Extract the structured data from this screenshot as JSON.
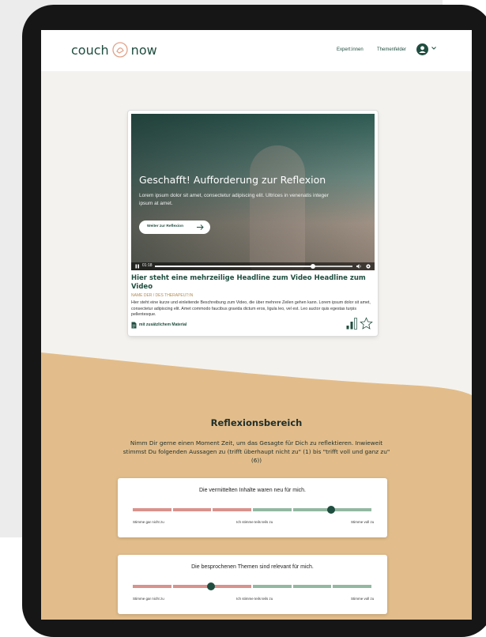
{
  "app": {
    "logo_left": "couch",
    "logo_right": "now",
    "nav": [
      {
        "label": "Expert:innen"
      },
      {
        "label": "Themenfelder"
      }
    ]
  },
  "video_card": {
    "overlay": {
      "headline": "Geschafft! Aufforderung zur Reflexion",
      "text": "Lorem ipsum dolor sit amet, consectetur adipiscing elit. Ultrices in venenatis integer ipsum at amet.",
      "button_label": "Weiter zur Reflexion"
    },
    "player": {
      "time": "01:18",
      "progress": 0.8
    },
    "title": "Hier steht eine mehrzeilige Headline zum Video Headline zum Video",
    "name": "NAME DER / DES THERAPEUT:IN",
    "description": "Hier steht eine kurze und einleitende Beschreibung zum Video, die über mehrere Zeilen gehen kann. Lorem ipsum dolor sit amet, consectetur adipiscing elit. Amet commodo faucibus gravida dictum eros, ligula leo, vel est. Leo auctor quis egestas turpis pellentesque.",
    "material_label": "mit zusätzlichem Material"
  },
  "reflection": {
    "title": "Reflexionsbereich",
    "intro": "Nimm Dir gerne einen Moment Zeit, um das Gesagte für Dich zu reflektieren. Inwieweit stimmst Du folgenden Aussagen zu (trifft überhaupt nicht zu\" (1) bis \"trifft voll und ganz zu\" (6))",
    "questions": [
      {
        "statement": "Die vermittelten Inhalte waren neu für mich.",
        "selected": 5,
        "label_low": "Stimme gar nicht zu",
        "label_mid": "Ich stimme teils teils zu",
        "label_high": "Stimme voll zu"
      },
      {
        "statement": "Die besprochenen Themen sind relevant für mich.",
        "selected": 2,
        "label_low": "Stimme gar nicht zu",
        "label_mid": "Ich stimme teils teils zu",
        "label_high": "Stimme voll zu"
      }
    ]
  },
  "colors": {
    "brand_green": "#1f4d3f",
    "sand": "#e2bd8b",
    "scale_red": "#d9928c",
    "scale_green": "#93b8a2"
  },
  "icons": {
    "logo_mark": "speech-bubble-icon",
    "avatar": "user-icon",
    "material": "document-icon",
    "levels": "signal-bars-icon",
    "favorite": "star-icon"
  }
}
